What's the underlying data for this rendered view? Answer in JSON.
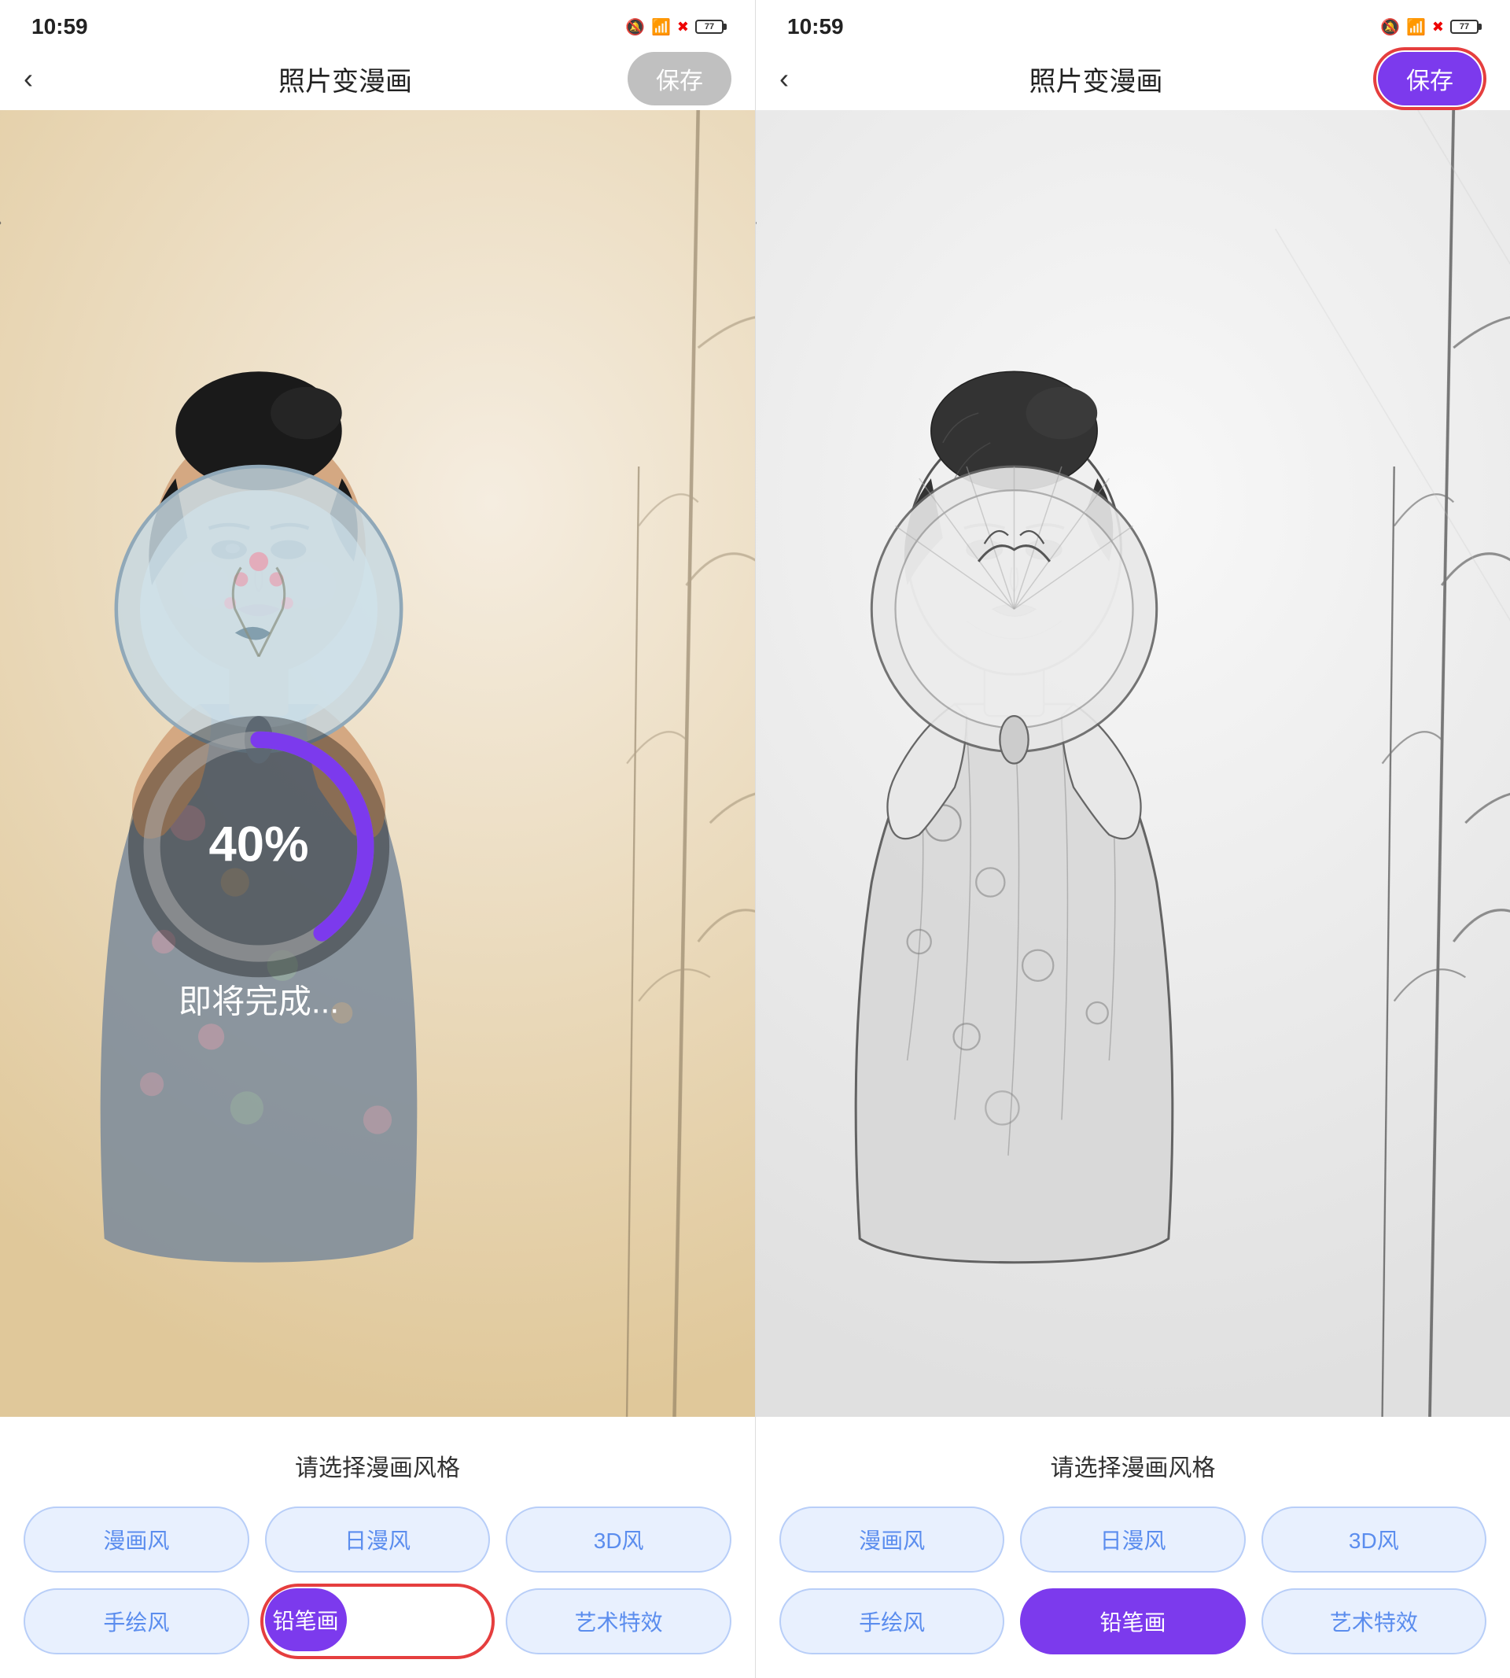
{
  "panels": [
    {
      "id": "left",
      "status": {
        "time": "10:59",
        "icons": [
          "bell-mute",
          "wifi",
          "x-signal",
          "battery"
        ],
        "battery_level": "77"
      },
      "nav": {
        "back_label": "‹",
        "title": "照片变漫画",
        "save_label": "保存",
        "save_active": false
      },
      "progress": {
        "percent": 40,
        "percent_label": "40%",
        "status_label": "即将完成..."
      },
      "style_section": {
        "title": "请选择漫画风格",
        "styles": [
          {
            "id": "manga",
            "label": "漫画风",
            "selected": false
          },
          {
            "id": "anime",
            "label": "日漫风",
            "selected": false
          },
          {
            "id": "3d",
            "label": "3D风",
            "selected": false
          },
          {
            "id": "hand",
            "label": "手绘风",
            "selected": false
          },
          {
            "id": "pencil",
            "label": "铅笔画",
            "selected": true,
            "highlighted": true
          },
          {
            "id": "art",
            "label": "艺术特效",
            "selected": false
          }
        ]
      }
    },
    {
      "id": "right",
      "status": {
        "time": "10:59",
        "icons": [
          "bell-mute",
          "wifi",
          "x-signal",
          "battery"
        ],
        "battery_level": "77"
      },
      "nav": {
        "back_label": "‹",
        "title": "照片变漫画",
        "save_label": "保存",
        "save_active": true
      },
      "style_section": {
        "title": "请选择漫画风格",
        "styles": [
          {
            "id": "manga",
            "label": "漫画风",
            "selected": false
          },
          {
            "id": "anime",
            "label": "日漫风",
            "selected": false
          },
          {
            "id": "3d",
            "label": "3D风",
            "selected": false
          },
          {
            "id": "hand",
            "label": "手绘风",
            "selected": false
          },
          {
            "id": "pencil",
            "label": "铅笔画",
            "selected": true
          },
          {
            "id": "art",
            "label": "艺术特效",
            "selected": false
          }
        ]
      }
    }
  ],
  "colors": {
    "purple": "#7c3aed",
    "light_blue_bg": "#e8f0fe",
    "light_blue_border": "#b8cef8",
    "light_blue_text": "#5b8dee",
    "progress_bg": "rgba(180,180,180,0.5)",
    "red_highlight": "#e53e3e",
    "inactive_save": "#c0c0c0"
  }
}
